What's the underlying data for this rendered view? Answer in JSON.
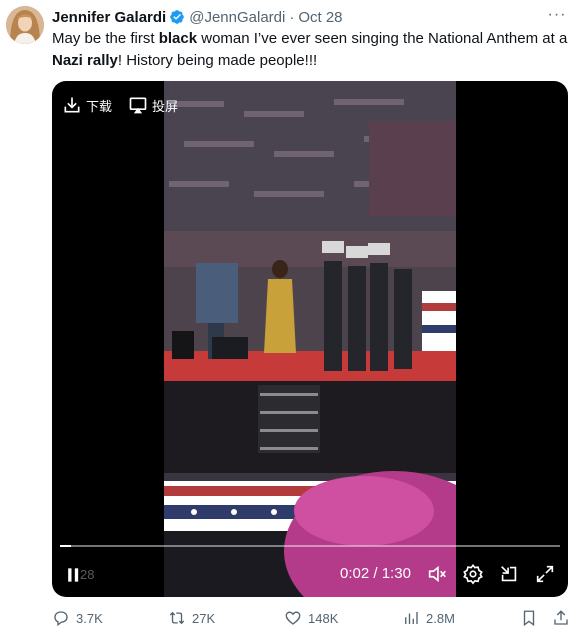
{
  "author": {
    "name": "Jennifer Galardi",
    "handle": "@JennGalardi",
    "separator": "·",
    "date": "Oct 28",
    "verified": true,
    "avatar_icon": "profile-photo"
  },
  "more_label": "···",
  "tweet_text": {
    "p1": "May be the first ",
    "b1": "black",
    "p2": " woman I’ve ever seen singing the National Anthem at a ",
    "b2": "Nazi rally",
    "p3": "! History being made people!!!"
  },
  "video": {
    "download_label": "下载",
    "cast_label": "投屏",
    "elapsed": "0:02",
    "time_separator": " / ",
    "duration": "1:30",
    "ghost_time": "28",
    "progress_fraction": 0.022,
    "icons": [
      "download-icon",
      "cast-icon",
      "play-pause-icon",
      "volume-muted-icon",
      "settings-icon",
      "minimize-icon",
      "fullscreen-icon"
    ]
  },
  "actions": {
    "replies": "3.7K",
    "reposts": "27K",
    "likes": "148K",
    "views": "2.8M"
  },
  "colors": {
    "text": "#0f1419",
    "secondary": "#536471",
    "verified": "#1d9bf0",
    "media_bg": "#000000"
  }
}
